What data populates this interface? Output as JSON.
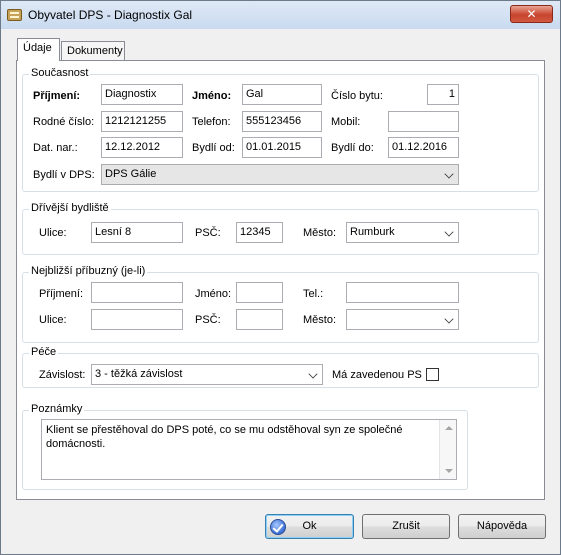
{
  "window": {
    "title": "Obyvatel DPS - Diagnostix Gal",
    "close_glyph": "✕"
  },
  "tabs": [
    {
      "label": "Údaje"
    },
    {
      "label": "Dokumenty"
    }
  ],
  "soucasnost": {
    "title": "Současnost",
    "prijmeni_label": "Příjmení:",
    "prijmeni": "Diagnostix",
    "jmeno_label": "Jméno:",
    "jmeno": "Gal",
    "cislo_bytu_label": "Číslo bytu:",
    "cislo_bytu": "1",
    "rodne_cislo_label": "Rodné číslo:",
    "rodne_cislo": "1212121255",
    "telefon_label": "Telefon:",
    "telefon": "555123456",
    "mobil_label": "Mobil:",
    "mobil": "",
    "dat_nar_label": "Dat. nar.:",
    "dat_nar": "12.12.2012",
    "bydli_od_label": "Bydlí od:",
    "bydli_od": "01.01.2015",
    "bydli_do_label": "Bydlí do:",
    "bydli_do": "01.12.2016",
    "bydli_v_dps_label": "Bydlí v DPS:",
    "bydli_v_dps": "DPS Gálie"
  },
  "drivejsi": {
    "title": "Dřívější bydliště",
    "ulice_label": "Ulice:",
    "ulice": "Lesní 8",
    "psc_label": "PSČ:",
    "psc": "12345",
    "mesto_label": "Město:",
    "mesto": "Rumburk"
  },
  "pribuzny": {
    "title": "Nejbližší příbuzný (je-li)",
    "prijmeni_label": "Příjmení:",
    "prijmeni": "",
    "jmeno_label": "Jméno:",
    "jmeno": "",
    "tel_label": "Tel.:",
    "tel": "",
    "ulice_label": "Ulice:",
    "ulice": "",
    "psc_label": "PSČ:",
    "psc": "",
    "mesto_label": "Město:",
    "mesto": ""
  },
  "pece": {
    "title": "Péče",
    "zavislost_label": "Závislost:",
    "zavislost": "3 - těžká závislost",
    "ps_label": "Má zavedenou PS",
    "ps_checked": false
  },
  "poznamky": {
    "title": "Poznámky",
    "text": "Klient se přestěhoval do DPS poté, co se mu odstěhoval syn ze společné domácnosti."
  },
  "buttons": {
    "ok": "Ok",
    "zrusit": "Zrušit",
    "napoveda": "Nápověda"
  }
}
